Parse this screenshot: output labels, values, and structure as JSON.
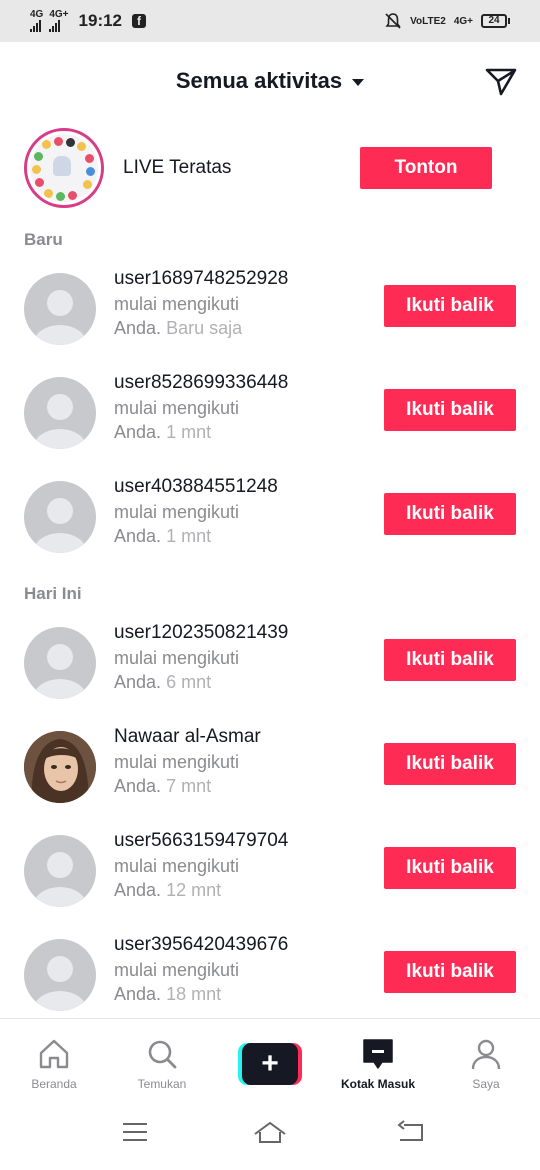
{
  "status_bar": {
    "net1": "4G",
    "net2": "4G+",
    "time": "19:12",
    "volte": "VoLTE2",
    "net3": "4G+",
    "battery": "24"
  },
  "header": {
    "title": "Semua aktivitas"
  },
  "live": {
    "label": "LIVE Teratas",
    "button": "Tonton"
  },
  "sections": {
    "new": "Baru",
    "today": "Hari Ini"
  },
  "notifications": [
    {
      "name": "user1689748252928",
      "action": "mulai mengikuti",
      "target": "Anda.",
      "time": "Baru saja",
      "button": "Ikuti balik"
    },
    {
      "name": "user8528699336448",
      "action": "mulai mengikuti",
      "target": "Anda.",
      "time": "1 mnt",
      "button": "Ikuti balik"
    },
    {
      "name": "user403884551248",
      "action": "mulai mengikuti",
      "target": "Anda.",
      "time": "1 mnt",
      "button": "Ikuti balik"
    },
    {
      "name": "user1202350821439",
      "action": "mulai mengikuti",
      "target": "Anda.",
      "time": "6 mnt",
      "button": "Ikuti balik"
    },
    {
      "name": "Nawaar al-Asmar",
      "action": "mulai mengikuti",
      "target": "Anda.",
      "time": "7 mnt",
      "button": "Ikuti balik"
    },
    {
      "name": "user5663159479704",
      "action": "mulai mengikuti",
      "target": "Anda.",
      "time": "12 mnt",
      "button": "Ikuti balik"
    },
    {
      "name": "user3956420439676",
      "action": "mulai mengikuti",
      "target": "Anda.",
      "time": "18 mnt",
      "button": "Ikuti balik"
    }
  ],
  "nav": {
    "home": "Beranda",
    "discover": "Temukan",
    "create": "+",
    "inbox": "Kotak Masuk",
    "profile": "Saya"
  },
  "colors": {
    "accent": "#fe2c55",
    "cyan": "#25f4ee",
    "text": "#161823",
    "muted": "#8a8b91"
  },
  "icons": [
    "send-icon",
    "dropdown-caret-icon",
    "home-icon",
    "search-icon",
    "plus-icon",
    "inbox-icon",
    "profile-icon",
    "menu-icon",
    "home-outline-icon",
    "back-icon"
  ]
}
